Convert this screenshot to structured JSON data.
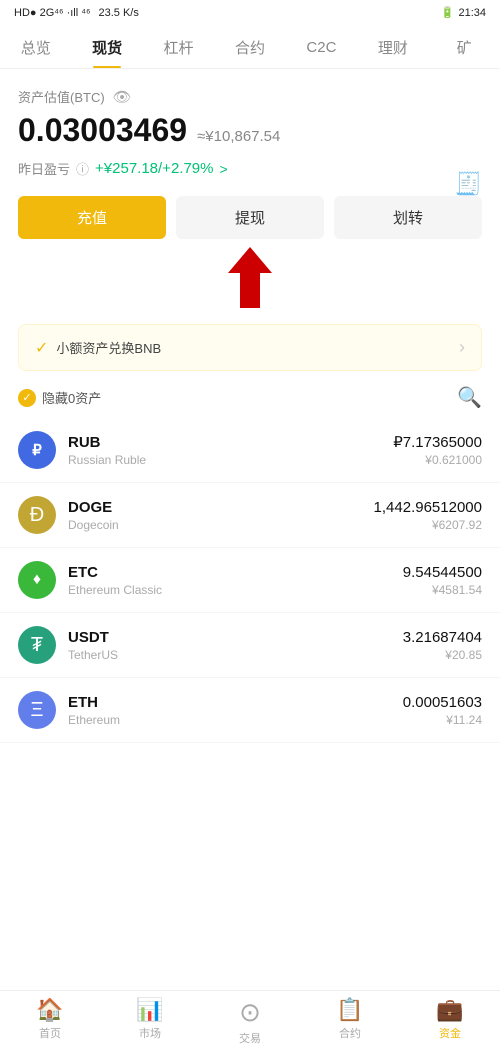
{
  "statusBar": {
    "left": "HD● 2G⁴⁶ .ⁿll ⁴⁶ ⁴⁶",
    "speed": "23.5 K/s",
    "time": "21:34"
  },
  "navTabs": [
    {
      "id": "overview",
      "label": "总览",
      "active": false
    },
    {
      "id": "spot",
      "label": "现货",
      "active": true
    },
    {
      "id": "leverage",
      "label": "杠杆",
      "active": false
    },
    {
      "id": "contract",
      "label": "合约",
      "active": false
    },
    {
      "id": "c2c",
      "label": "C2C",
      "active": false
    },
    {
      "id": "finance",
      "label": "理财",
      "active": false
    },
    {
      "id": "mine",
      "label": "矿",
      "active": false
    }
  ],
  "portfolio": {
    "assetLabel": "资产估值(BTC)",
    "btcValue": "0.03003469",
    "cnyApprox": "≈¥10,867.54",
    "profitLabel": "昨日盈亏",
    "profitValue": "+¥257.18/+2.79%",
    "profitArrow": ">"
  },
  "actions": {
    "deposit": "充值",
    "withdraw": "提现",
    "transfer": "划转"
  },
  "bnbBanner": {
    "text": "小额资产兑换BNB",
    "arrow": "›"
  },
  "assetListHeader": {
    "hideLabel": "隐藏0资产",
    "searchIcon": "🔍"
  },
  "assets": [
    {
      "symbol": "RUB",
      "name": "Russian Ruble",
      "iconType": "rub",
      "iconChar": "₽",
      "amount": "₽7.17365000",
      "cny": "¥0.621000"
    },
    {
      "symbol": "DOGE",
      "name": "Dogecoin",
      "iconType": "doge",
      "iconChar": "Ð",
      "amount": "1,442.96512000",
      "cny": "¥6207.92"
    },
    {
      "symbol": "ETC",
      "name": "Ethereum Classic",
      "iconType": "etc",
      "iconChar": "♦",
      "amount": "9.54544500",
      "cny": "¥4581.54"
    },
    {
      "symbol": "USDT",
      "name": "TetherUS",
      "iconType": "usdt",
      "iconChar": "₮",
      "amount": "3.21687404",
      "cny": "¥20.85"
    },
    {
      "symbol": "ETH",
      "name": "Ethereum",
      "iconType": "eth",
      "iconChar": "Ξ",
      "amount": "0.00051603",
      "cny": "¥11.24"
    }
  ],
  "bottomNav": [
    {
      "id": "home",
      "label": "首页",
      "icon": "🏠",
      "active": false
    },
    {
      "id": "market",
      "label": "市场",
      "icon": "📊",
      "active": false
    },
    {
      "id": "trade",
      "label": "交易",
      "icon": "🔄",
      "active": false
    },
    {
      "id": "contract",
      "label": "合约",
      "icon": "📋",
      "active": false
    },
    {
      "id": "assets",
      "label": "资金",
      "icon": "💼",
      "active": true
    }
  ]
}
